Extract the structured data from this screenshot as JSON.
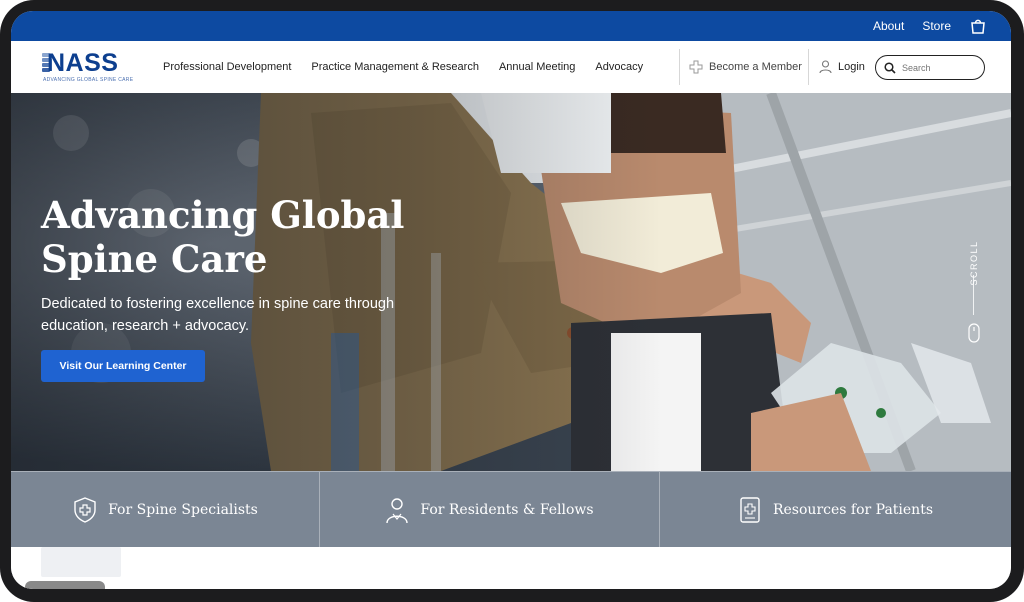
{
  "utility_bar": {
    "about_label": "About",
    "store_label": "Store",
    "cart_icon": "shopping-bag-icon"
  },
  "header": {
    "logo": {
      "wordmark": "NASS",
      "tagline": "ADVANCING GLOBAL SPINE CARE"
    },
    "nav": [
      {
        "label": "Professional Development"
      },
      {
        "label": "Practice Management & Research"
      },
      {
        "label": "Annual Meeting"
      },
      {
        "label": "Advocacy"
      }
    ],
    "member_label": "Become a Member",
    "login_label": "Login",
    "search_placeholder": "Search"
  },
  "hero": {
    "title": "Advancing Global Spine Care",
    "subtitle": "Dedicated to fostering excellence in spine care through education, research + advocacy.",
    "cta_label": "Visit Our Learning Center",
    "scroll_label": "SCROLL"
  },
  "audience": [
    {
      "label": "For Spine Specialists",
      "icon": "shield-cross-icon"
    },
    {
      "label": "For Residents & Fellows",
      "icon": "doctor-icon"
    },
    {
      "label": "Resources for Patients",
      "icon": "medical-document-icon"
    }
  ],
  "colors": {
    "utility_bar": "#0d4aa1",
    "cta": "#1f63d1",
    "brand_navy": "#0d3f8f"
  }
}
